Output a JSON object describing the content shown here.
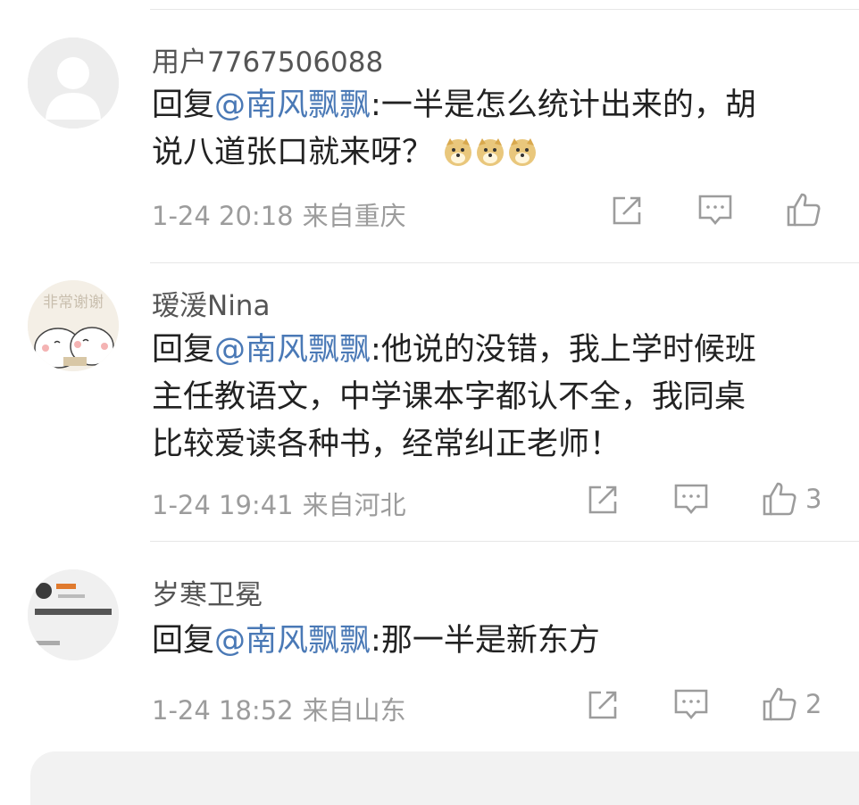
{
  "comments": [
    {
      "user": "用户7767506088",
      "reply_prefix": "回复",
      "mention": "@南风飘飘",
      "text_line1": ":一半是怎么统计出来的，胡",
      "text_line2": "说八道张口就来呀？",
      "emoji": [
        "doge-emoji",
        "doge-emoji",
        "doge-emoji"
      ],
      "date": "1-24 20:18",
      "location": "来自重庆",
      "likes": ""
    },
    {
      "user": "瑷湲Nina",
      "avatar_text": "非常谢谢",
      "reply_prefix": "回复",
      "mention": "@南风飘飘",
      "text_line1": ":他说的没错，我上学时候班",
      "text_line2": "主任教语文，中学课本字都认不全，我同桌",
      "text_line3": "比较爱读各种书，经常纠正老师！",
      "date": "1-24 19:41",
      "location": "来自河北",
      "likes": "3"
    },
    {
      "user": "岁寒卫冕",
      "reply_prefix": "回复",
      "mention": "@南风飘飘",
      "text_line1": ":那一半是新东方",
      "date": "1-24 18:52",
      "location": "来自山东",
      "likes": "2"
    }
  ],
  "colors": {
    "mention": "#4a79b6",
    "meta": "#9c9c9c"
  }
}
